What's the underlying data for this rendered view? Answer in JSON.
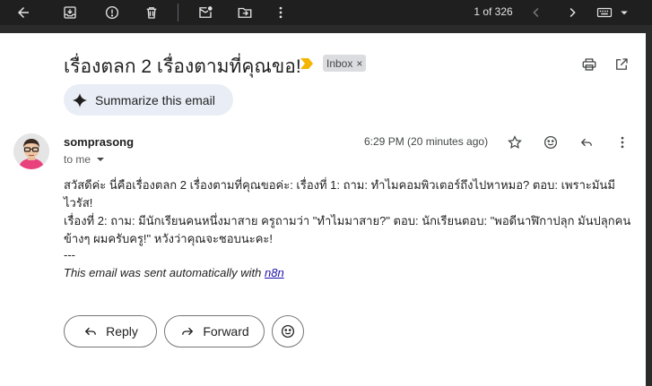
{
  "toolbar": {
    "icons": [
      "back-arrow-icon",
      "archive-icon",
      "report-spam-icon",
      "delete-icon",
      "mark-unread-icon",
      "move-to-icon",
      "more-vert-icon"
    ],
    "pager_text": "1 of 326",
    "nav_icons": [
      "chevron-left-icon",
      "chevron-right-icon",
      "keyboard-icon",
      "dropdown-icon"
    ]
  },
  "email": {
    "subject": "เรื่องตลก 2 เรื่องตามที่คุณขอ!",
    "label": "Inbox",
    "label_close": "×",
    "summarize_label": "Summarize this email",
    "sender": "somprasong",
    "recipient_text": "to me",
    "time": "6:29 PM (20 minutes ago)",
    "body": "สวัสดีค่ะ นี่คือเรื่องตลก 2 เรื่องตามที่คุณขอค่ะ: เรื่องที่ 1: ถาม: ทำไมคอมพิวเตอร์ถึงไปหาหมอ? ตอบ: เพราะมันมีไวรัส!\nเรื่องที่ 2: ถาม: มีนักเรียนคนหนึ่งมาสาย ครูถามว่า \"ทำไมมาสาย?\" ตอบ: นักเรียนตอบ: \"พอดีนาฬิกาปลุก มันปลุกคน\nข้างๆ ผมครับครู!\" หวังว่าคุณจะชอบนะคะ!",
    "signature_separator": "---",
    "signature_text": "This email was sent automatically with ",
    "signature_link": "n8n"
  },
  "actions": {
    "reply_label": "Reply",
    "forward_label": "Forward"
  },
  "colors": {
    "importance": "#f4b400",
    "link": "#1a0dab",
    "avatar_shirt": "#e8417b"
  }
}
